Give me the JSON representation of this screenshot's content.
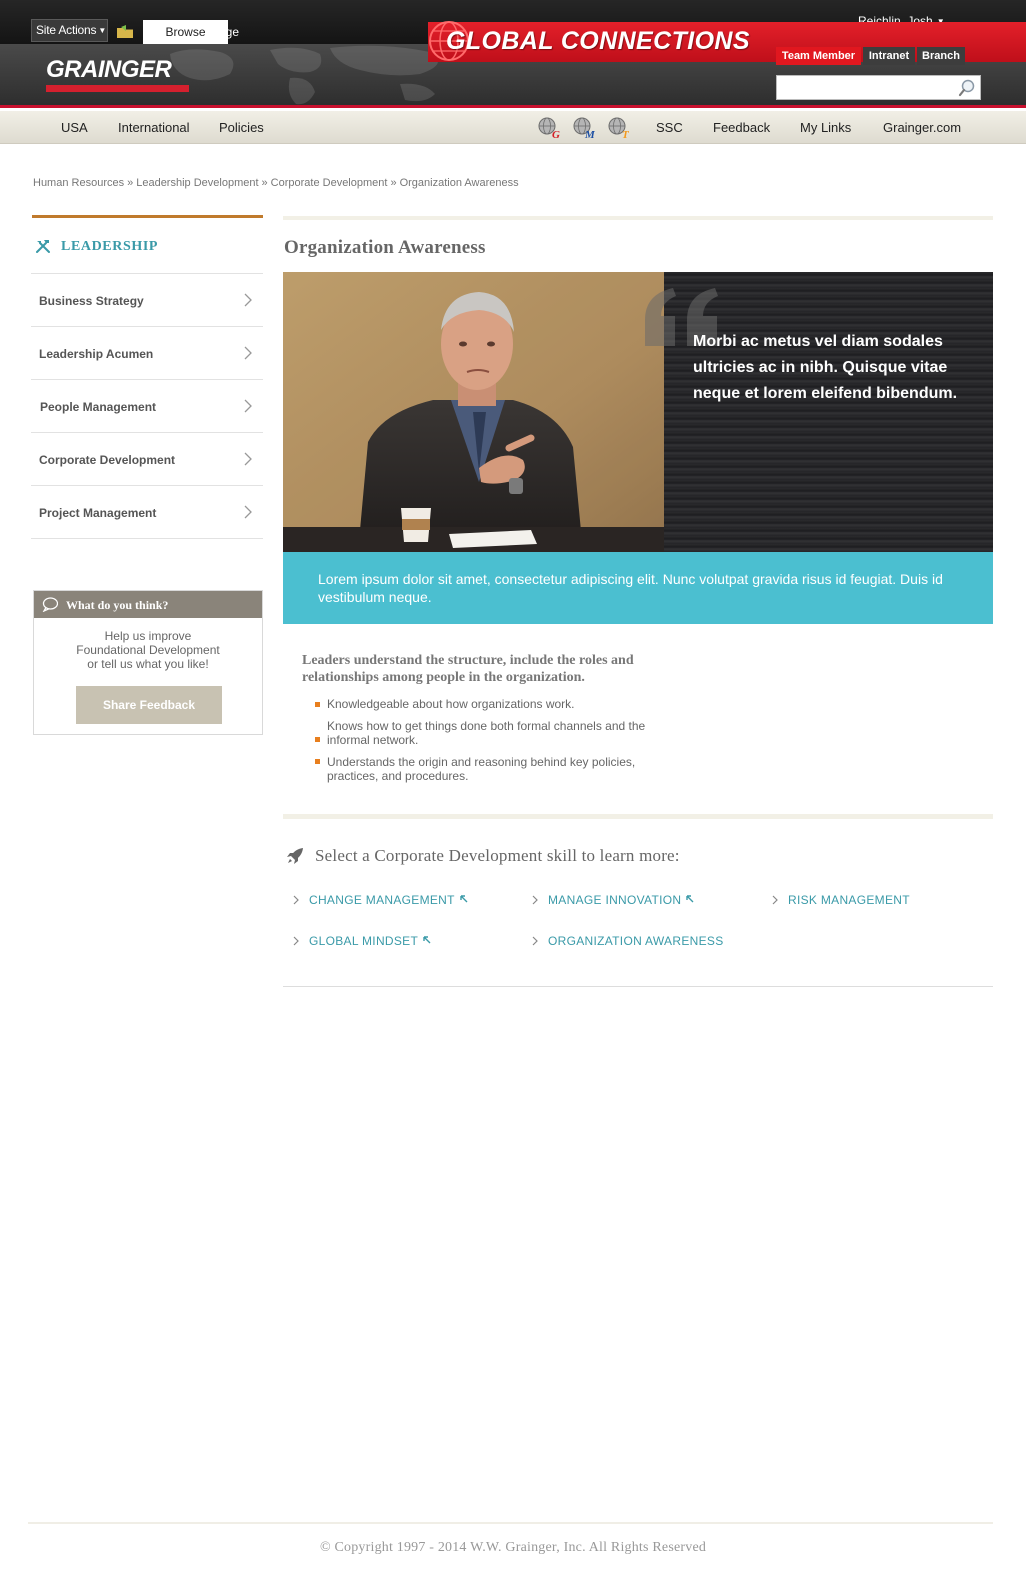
{
  "ribbon": {
    "site_actions_label": "Site Actions",
    "tabs": [
      {
        "label": "Browse"
      },
      {
        "label": "Page"
      }
    ],
    "user_name": "Reichlin, Josh"
  },
  "brand": {
    "logo_text": "GRAINGER",
    "banner_title": "GLOBAL CONNECTIONS",
    "audience_tabs": [
      {
        "label": "Team Member"
      },
      {
        "label": "Intranet"
      },
      {
        "label": "Branch"
      }
    ],
    "search_value": "",
    "colors": {
      "brand_red": "#e1171f",
      "teal": "#4bbfd0",
      "link_teal": "#3a9aa8",
      "accent_orange": "#c07a2c"
    }
  },
  "nav": {
    "left_items": [
      {
        "label": "USA"
      },
      {
        "label": "International"
      },
      {
        "label": "Policies"
      }
    ],
    "tool_icons": [
      {
        "name": "globe-g-icon",
        "letter": "G"
      },
      {
        "name": "globe-m-icon",
        "letter": "M"
      },
      {
        "name": "globe-t-icon",
        "letter": "T"
      }
    ],
    "right_items": [
      {
        "label": "SSC"
      },
      {
        "label": "Feedback"
      },
      {
        "label": "My Links"
      },
      {
        "label": "Grainger.com"
      }
    ]
  },
  "breadcrumb": {
    "items": [
      {
        "label": "Human Resources"
      },
      {
        "label": "Leadership Development"
      },
      {
        "label": "Corporate Development"
      },
      {
        "label": "Organization Awareness"
      }
    ],
    "separator": "»"
  },
  "sidebar": {
    "heading": "LEADERSHIP",
    "items": [
      {
        "label": "Business Strategy"
      },
      {
        "label": "Leadership Acumen"
      },
      {
        "label": "People Management"
      },
      {
        "label": "Corporate Development"
      },
      {
        "label": "Project Management"
      }
    ],
    "feedback": {
      "heading": "What do you think?",
      "line1": "Help us improve",
      "line2": "Foundational Development",
      "line3": "or tell us what you like!",
      "button_label": "Share Feedback"
    }
  },
  "main": {
    "title": "Organization Awareness",
    "hero_quote": "Morbi ac metus vel diam sodales ultricies ac in nibh. Quisque vitae neque et lorem eleifend bibendum.",
    "band_text": "Lorem ipsum dolor sit amet, consectetur adipiscing elit. Nunc volutpat gravida risus id feugiat. Duis id vestibulum neque.",
    "lead_text": "Leaders understand the structure, include the roles and relationships among people in the organization.",
    "bullets": [
      "Knowledgeable about how organizations work.",
      "Knows how to get things done both formal channels and the informal network.",
      "Understands the origin and reasoning behind key policies, practices, and procedures."
    ],
    "skills_heading": "Select a Corporate Development skill to learn more:",
    "skills": [
      {
        "label": "CHANGE MANAGEMENT",
        "external": true
      },
      {
        "label": "MANAGE INNOVATION",
        "external": true
      },
      {
        "label": "RISK MANAGEMENT",
        "external": false
      },
      {
        "label": "GLOBAL MINDSET",
        "external": true
      },
      {
        "label": "ORGANIZATION AWARENESS",
        "external": false
      }
    ]
  },
  "footer": {
    "copyright": "© Copyright 1997 - 2014 W.W. Grainger, Inc. All Rights Reserved"
  }
}
